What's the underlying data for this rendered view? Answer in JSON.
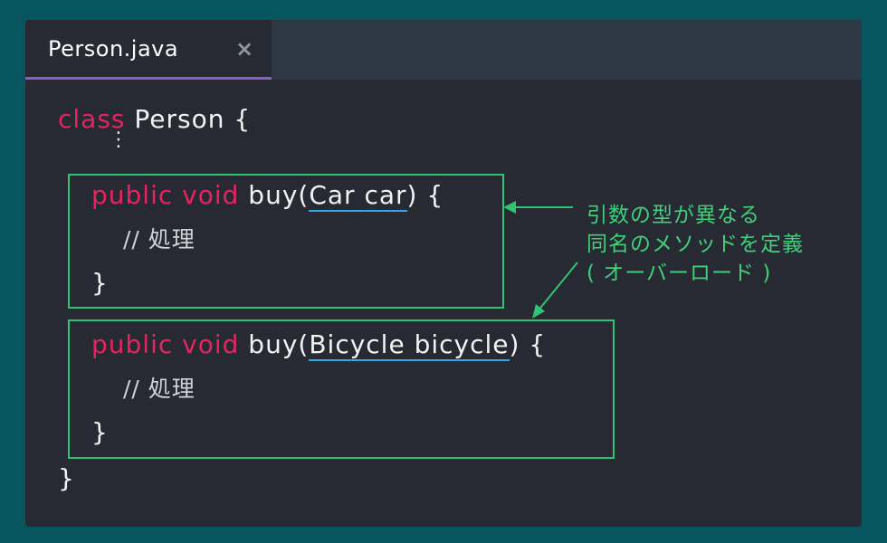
{
  "tab": {
    "title": "Person.java",
    "close_glyph": "×"
  },
  "code": {
    "line1_kw": "class",
    "line1_rest": " Person {",
    "ellipsis": "⋮",
    "method1": {
      "kw": "public void",
      "name": " buy(",
      "param": "Car car",
      "close": ") {"
    },
    "method2": {
      "kw": "public void",
      "name": " buy(",
      "param": "Bicycle bicycle",
      "close": ") {"
    },
    "comment": "// 処理",
    "brace_close": "}"
  },
  "annotation": {
    "line1": "引数の型が異なる",
    "line2": "同名のメソッドを定義",
    "line3": "( オーバーロード )"
  },
  "colors": {
    "background": "#07555f",
    "keyword": "#e5245f",
    "highlight_box": "#2ec474",
    "underline": "#33a6e8",
    "tab_indicator": "#8d5cc4"
  }
}
